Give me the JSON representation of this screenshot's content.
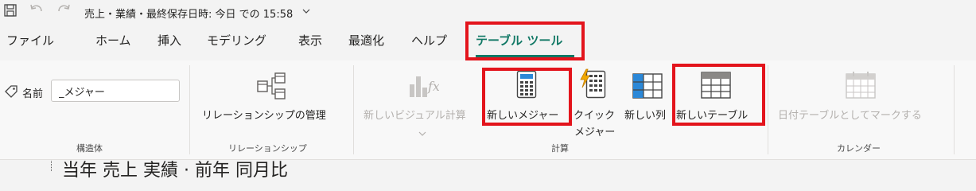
{
  "titlebar": {
    "title": "売上・業績・最終保存日時: 今日 での 15:58"
  },
  "tabs": [
    {
      "label": "ファイル"
    },
    {
      "label": "ホーム"
    },
    {
      "label": "挿入"
    },
    {
      "label": "モデリング"
    },
    {
      "label": "表示"
    },
    {
      "label": "最適化"
    },
    {
      "label": "ヘルプ"
    },
    {
      "label": "テーブル ツール"
    }
  ],
  "ribbon": {
    "structure": {
      "name_label": "名前",
      "name_value": "_メジャー",
      "group_label": "構造体"
    },
    "relationships": {
      "manage_label": "リレーションシップの管理",
      "group_label": "リレーションシップ"
    },
    "calculations": {
      "new_visual_calc_label": "新しいビジュアル計算",
      "new_measure_label": "新しいメジャー",
      "quick_measure_line1": "クイック",
      "quick_measure_line2": "メジャー",
      "new_column_label": "新しい列",
      "new_table_label": "新しいテーブル",
      "group_label": "計算"
    },
    "calendars": {
      "mark_date_table_label": "日付テーブルとしてマークする",
      "group_label": "カレンダー"
    }
  },
  "canvas": {
    "partial_text": "当年 売上 実績 · 前年 同月比"
  },
  "colors": {
    "accent": "#117865",
    "highlight": "#e3141c",
    "disabled": "#b3b0ad"
  }
}
